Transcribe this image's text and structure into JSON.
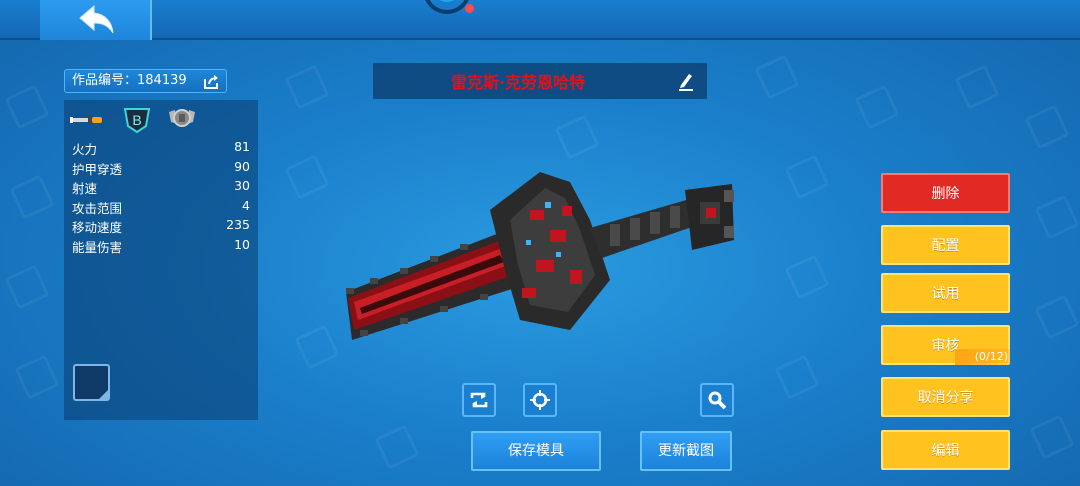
{
  "header": {
    "back_icon": "back-arrow-icon"
  },
  "work": {
    "id_label": "作品编号：184139",
    "share_icon": "share-icon"
  },
  "weapon": {
    "name": "雷克斯·克劳恩哈特",
    "name_color": "#e0121c",
    "badges": [
      "knife-icon",
      "rank-b-badge-icon",
      "level-badge-icon"
    ],
    "badge_rank_letter": "B"
  },
  "stats": [
    {
      "label": "火力",
      "value": "81"
    },
    {
      "label": "护甲穿透",
      "value": "90"
    },
    {
      "label": "射速",
      "value": "30"
    },
    {
      "label": "攻击范围",
      "value": "4"
    },
    {
      "label": "移动速度",
      "value": "235"
    },
    {
      "label": "能量伤害",
      "value": "10"
    }
  ],
  "tools": {
    "rotate_icon": "rotate-icon",
    "center_icon": "crosshair-icon",
    "zoom_icon": "magnifier-icon"
  },
  "bottom_buttons": {
    "save_model": "保存模具",
    "update_screenshot": "更新截图"
  },
  "side_buttons": {
    "delete": "删除",
    "configure": "配置",
    "try": "试用",
    "review": "审核",
    "review_count": "(0/12)",
    "cancel_share": "取消分享",
    "edit": "编辑"
  },
  "colors": {
    "delete": "#e22a25",
    "action": "#ffc21f",
    "primary": "#1c83d8"
  }
}
